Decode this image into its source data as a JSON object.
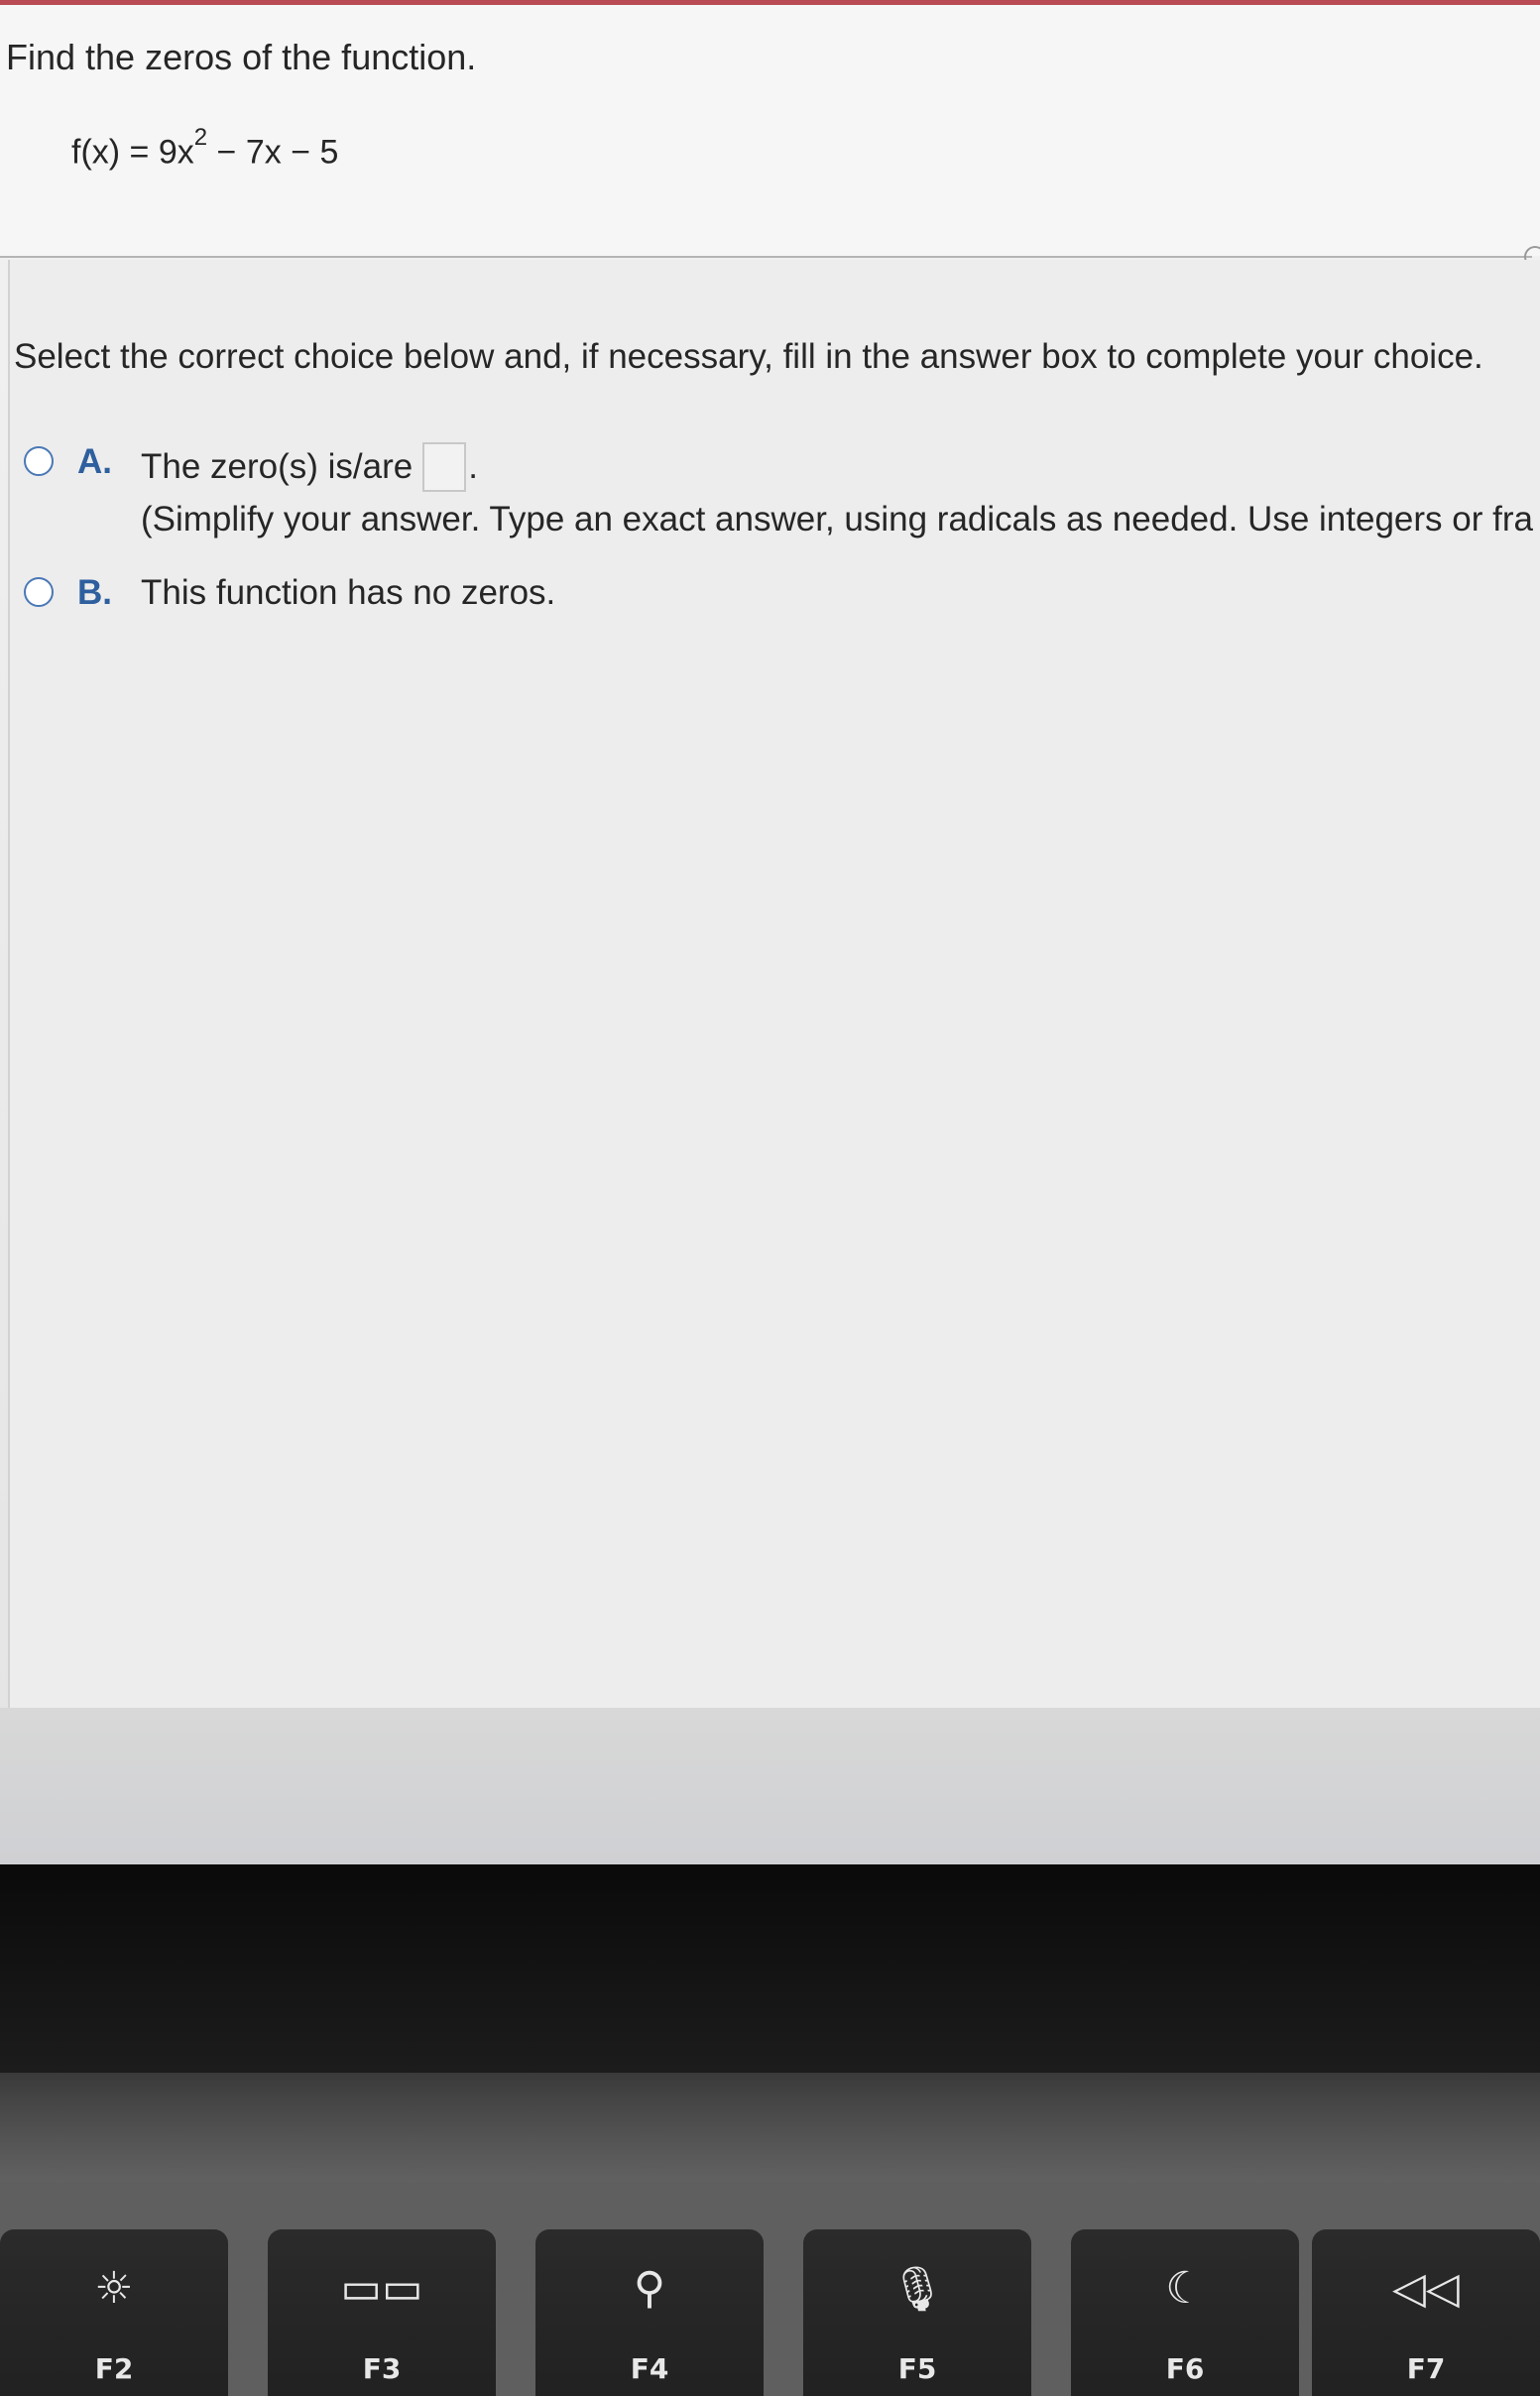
{
  "question": {
    "prompt": "Find the zeros of the function.",
    "formula_lhs": "f(x) = 9x",
    "formula_exponent": "2",
    "formula_rhs": " − 7x − 5"
  },
  "answer": {
    "instructions": "Select the correct choice below and, if necessary, fill in the answer box to complete your choice.",
    "choice_a": {
      "letter": "A.",
      "label": "The zero(s) is/are",
      "period": ".",
      "hint": "(Simplify your answer. Type an exact answer, using radicals as needed. Use integers or fra"
    },
    "choice_b": {
      "letter": "B.",
      "label": "This function has no zeros."
    }
  },
  "keyboard": {
    "keys": [
      {
        "label": "F2",
        "icon": "brightness-up-icon",
        "glyph": "☼"
      },
      {
        "label": "F3",
        "icon": "mission-control-icon",
        "glyph": "▭▭"
      },
      {
        "label": "F4",
        "icon": "search-icon",
        "glyph": "⚲"
      },
      {
        "label": "F5",
        "icon": "microphone-icon",
        "glyph": "🎙"
      },
      {
        "label": "F6",
        "icon": "moon-icon",
        "glyph": "☾"
      },
      {
        "label": "F7",
        "icon": "rewind-icon",
        "glyph": "◁◁"
      }
    ]
  }
}
